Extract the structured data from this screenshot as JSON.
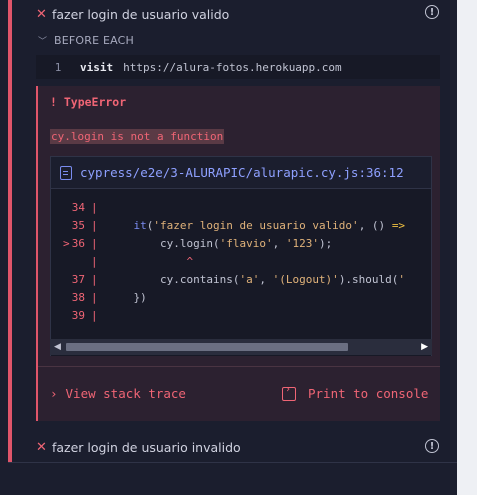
{
  "tests": [
    {
      "title": "fazer login de usuario valido",
      "status": "failed"
    },
    {
      "title": "fazer login de usuario invalido",
      "status": "failed"
    }
  ],
  "hook": {
    "label": "BEFORE EACH"
  },
  "command": {
    "number": "1",
    "name": "visit",
    "message": "https://alura-fotos.herokuapp.com"
  },
  "error": {
    "title": "! TypeError",
    "message": "cy.login is not a function",
    "file_path": "cypress/e2e/3-ALURAPIC/alurapic.cy.js:36:12",
    "code_lines": [
      {
        "num": "34",
        "code": ""
      },
      {
        "num": "35",
        "code": "    it('fazer login de usuario valido', () =>"
      },
      {
        "num": "36",
        "code": "        cy.login('flavio', '123');",
        "active": true
      },
      {
        "num": "",
        "code": "            ^"
      },
      {
        "num": "37",
        "code": "        cy.contains('a', '(Logout)').should('"
      },
      {
        "num": "38",
        "code": "    })"
      },
      {
        "num": "39",
        "code": ""
      }
    ],
    "stack_trace_label": "View stack trace",
    "print_label": "Print to console"
  },
  "icons": {
    "failed": "x-icon",
    "info": "info-icon",
    "file": "file-icon",
    "terminal": "terminal-icon"
  },
  "colors": {
    "error": "#f06575",
    "accent": "#8ea0ff",
    "background": "#1b1e2e"
  }
}
